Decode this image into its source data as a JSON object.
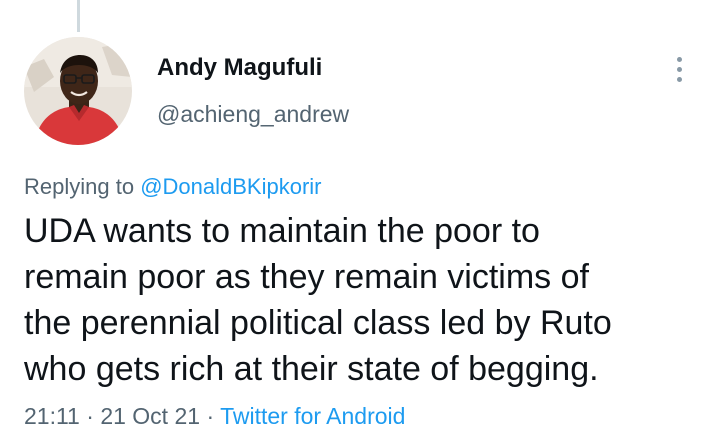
{
  "tweet": {
    "author": {
      "name": "Andy Magufuli",
      "handle": "@achieng_andrew"
    },
    "replying_prefix": "Replying to ",
    "replying_to": "@DonaldBKipkorir",
    "text_lines": [
      "UDA wants to maintain the poor to",
      "remain poor as they remain victims of",
      "the perennial political class led by Ruto",
      "who gets rich at their state of begging."
    ],
    "time": "21:11",
    "date": "21 Oct 21",
    "separator": "·",
    "source": "Twitter for Android"
  },
  "colors": {
    "link": "#1d9bf0",
    "secondary_text": "#536471",
    "primary_text": "#0f1419"
  },
  "icons": {
    "more": "vertical-ellipsis"
  }
}
